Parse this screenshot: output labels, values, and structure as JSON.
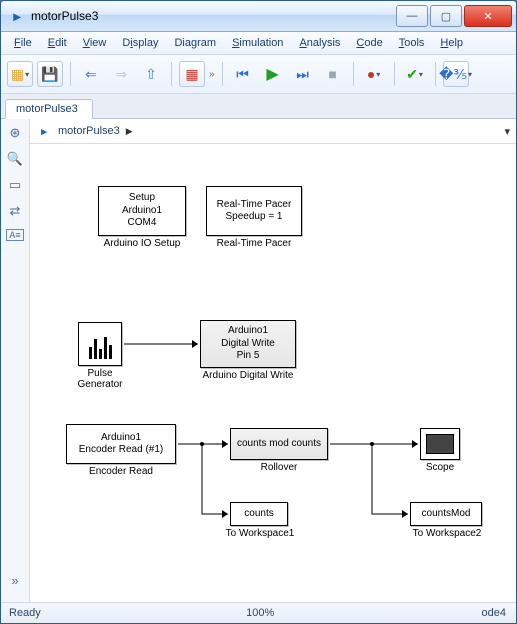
{
  "window": {
    "title": "motorPulse3"
  },
  "menu": {
    "file": "File",
    "edit": "Edit",
    "view": "View",
    "display": "Display",
    "diagram": "Diagram",
    "simulation": "Simulation",
    "analysis": "Analysis",
    "code": "Code",
    "tools": "Tools",
    "help": "Help"
  },
  "tabs": {
    "active": "motorPulse3"
  },
  "breadcrumb": {
    "model": "motorPulse3",
    "arrow": "▶"
  },
  "status": {
    "left": "Ready",
    "center": "100%",
    "right": "ode4"
  },
  "blocks": {
    "setup": {
      "line1": "Setup",
      "line2": "Arduino1",
      "line3": "COM4",
      "label": "Arduino IO Setup"
    },
    "pacer": {
      "line1": "Real-Time Pacer",
      "line2": "Speedup = 1",
      "label": "Real-Time Pacer"
    },
    "pulse": {
      "label": "Pulse\nGenerator"
    },
    "dwrite": {
      "line1": "Arduino1",
      "line2": "Digital Write",
      "line3": "Pin 5",
      "label": "Arduino Digital Write"
    },
    "encoder": {
      "line1": "Arduino1",
      "line2": "Encoder Read (#1)",
      "label": "Encoder Read"
    },
    "rollover": {
      "in": "counts",
      "out": "mod counts",
      "label": "Rollover"
    },
    "scope": {
      "label": "Scope"
    },
    "tows1": {
      "text": "counts",
      "label": "To Workspace1"
    },
    "tows2": {
      "text": "countsMod",
      "label": "To Workspace2"
    }
  }
}
